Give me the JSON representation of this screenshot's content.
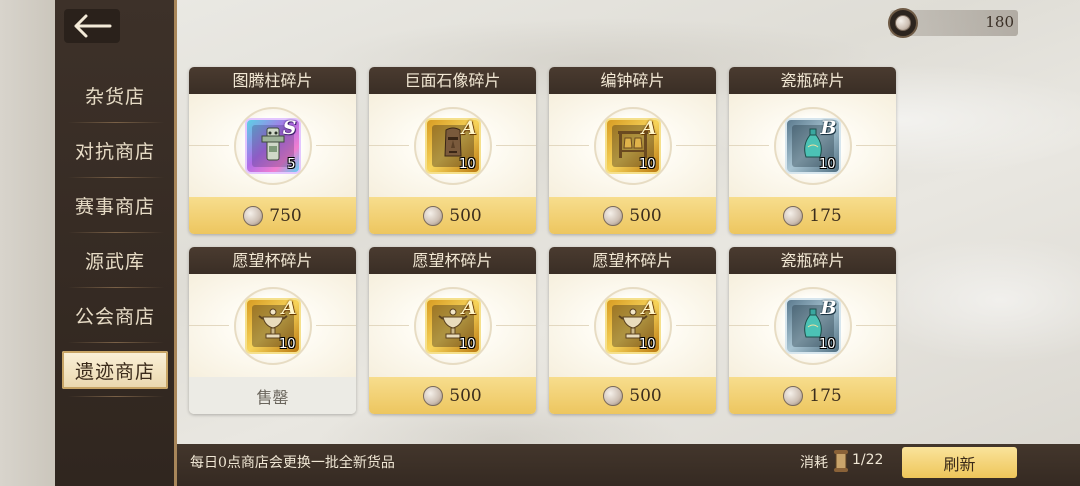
{
  "currency": {
    "value": "180",
    "icon": "shell-coin-icon"
  },
  "sidebar": {
    "items": [
      {
        "label": "杂货店"
      },
      {
        "label": "对抗商店"
      },
      {
        "label": "赛事商店"
      },
      {
        "label": "源武库"
      },
      {
        "label": "公会商店"
      },
      {
        "label": "遗迹商店",
        "active": true
      }
    ]
  },
  "items": [
    {
      "title": "图腾柱碎片",
      "grade": "S",
      "qty": "5",
      "price": "750",
      "art": "totem-icon"
    },
    {
      "title": "巨面石像碎片",
      "grade": "A",
      "qty": "10",
      "price": "500",
      "art": "moai-icon"
    },
    {
      "title": "编钟碎片",
      "grade": "A",
      "qty": "10",
      "price": "500",
      "art": "bells-icon"
    },
    {
      "title": "瓷瓶碎片",
      "grade": "B",
      "qty": "10",
      "price": "175",
      "art": "vase-icon"
    },
    {
      "title": "愿望杯碎片",
      "grade": "A",
      "qty": "10",
      "price": "售罄",
      "soldout": true,
      "art": "cup-icon"
    },
    {
      "title": "愿望杯碎片",
      "grade": "A",
      "qty": "10",
      "price": "500",
      "art": "cup-icon"
    },
    {
      "title": "愿望杯碎片",
      "grade": "A",
      "qty": "10",
      "price": "500",
      "art": "cup-icon"
    },
    {
      "title": "瓷瓶碎片",
      "grade": "B",
      "qty": "10",
      "price": "175",
      "art": "vase-icon"
    }
  ],
  "footer": {
    "notice": "每日0点商店会更换一批全新货品",
    "cost_label": "消耗",
    "cost_value": "1/22",
    "refresh_label": "刷新"
  },
  "colors": {
    "grade_S": "#b06ee8",
    "grade_A": "#f7d45a",
    "grade_B": "#a9c5d3",
    "price_bar": "#edc65f"
  }
}
